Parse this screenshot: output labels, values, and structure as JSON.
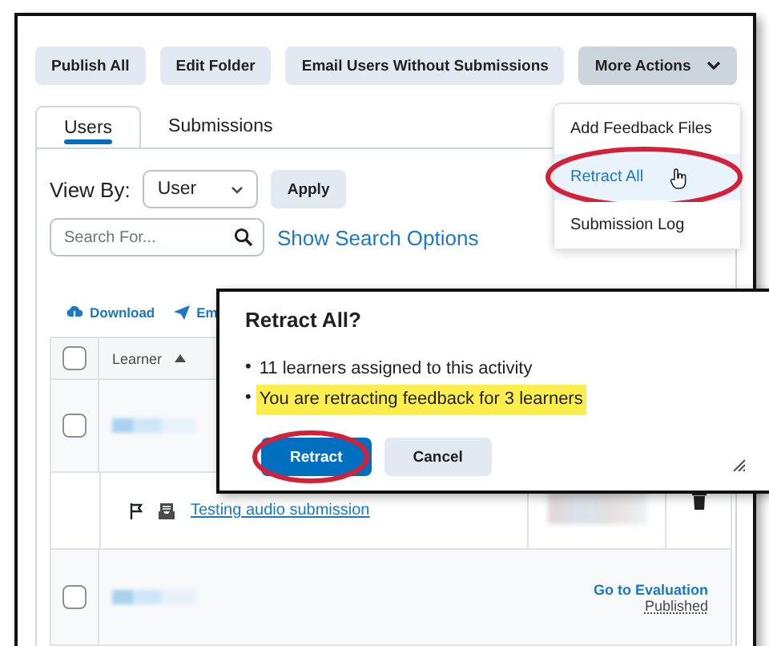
{
  "toolbar": {
    "buttons": [
      {
        "label": "Publish All"
      },
      {
        "label": "Edit Folder"
      },
      {
        "label": "Email Users Without Submissions"
      }
    ],
    "more_actions": {
      "label": "More Actions",
      "expanded": true
    }
  },
  "tabs": [
    {
      "label": "Users",
      "selected": true
    },
    {
      "label": "Submissions",
      "selected": false
    }
  ],
  "view_by": {
    "label": "View By:",
    "value": "User",
    "apply": "Apply"
  },
  "search": {
    "placeholder": "Search For...",
    "link": "Show Search Options"
  },
  "actions": [
    {
      "kind": "download",
      "label": "Download"
    },
    {
      "kind": "email",
      "label": "Em"
    }
  ],
  "table": {
    "select_all_checked": false,
    "columns": [
      {
        "label": "Learner"
      }
    ],
    "rows": [
      {
        "kind": "learner",
        "checked": false
      },
      {
        "kind": "submission",
        "title": "Testing audio submission"
      },
      {
        "kind": "learner",
        "checked": false,
        "link": "Go to Evaluation",
        "status": "Published"
      }
    ]
  },
  "menu": {
    "items": [
      {
        "label": "Add Feedback Files",
        "selected": false,
        "circled": false
      },
      {
        "label": "Retract All",
        "selected": true,
        "circled": true
      },
      {
        "label": "Submission Log",
        "selected": false,
        "circled": false
      }
    ]
  },
  "dialog": {
    "title": "Retract All?",
    "bullets": [
      {
        "marker": "•",
        "text": "11 learners assigned to this activity",
        "highlighted": false
      },
      {
        "marker": "•",
        "text": "You are retracting feedback for 3 learners",
        "highlighted": true
      }
    ],
    "buttons": [
      {
        "label": "Retract",
        "primary": true,
        "circled": true
      },
      {
        "label": "Cancel",
        "primary": false,
        "circled": false
      }
    ]
  }
}
